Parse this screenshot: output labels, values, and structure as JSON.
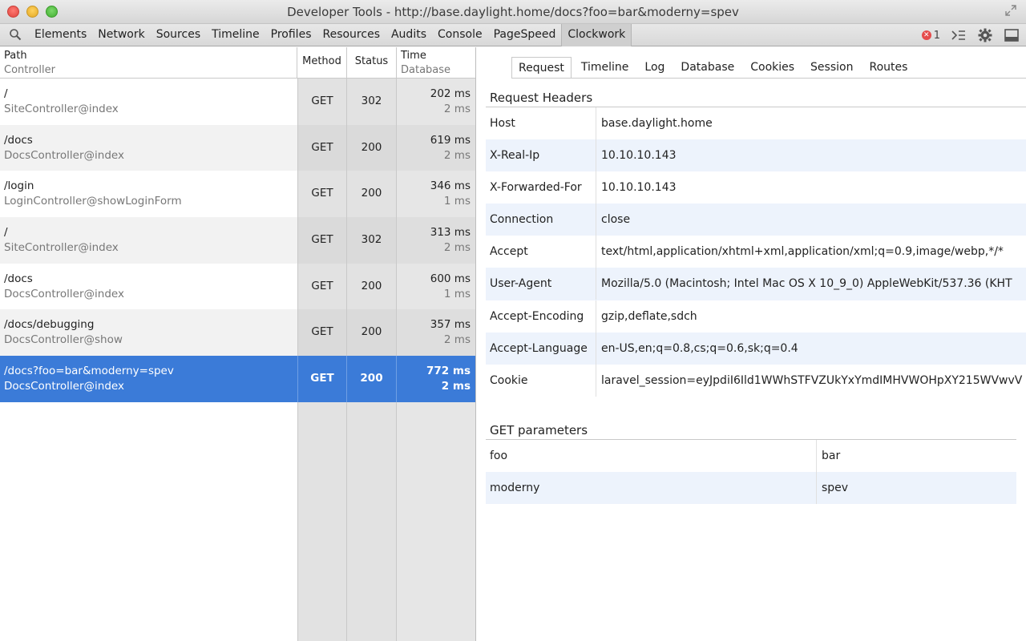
{
  "window": {
    "title": "Developer Tools - http://base.daylight.home/docs?foo=bar&moderny=spev"
  },
  "toolbar": {
    "tabs": [
      "Elements",
      "Network",
      "Sources",
      "Timeline",
      "Profiles",
      "Resources",
      "Audits",
      "Console",
      "PageSpeed",
      "Clockwork"
    ],
    "active_tab": "Clockwork",
    "error_count": "1",
    "error_glyph": "✕"
  },
  "requests_table": {
    "headers": {
      "path": "Path",
      "controller": "Controller",
      "method": "Method",
      "status": "Status",
      "time": "Time",
      "database": "Database"
    },
    "rows": [
      {
        "path": "/",
        "controller": "SiteController@index",
        "method": "GET",
        "status": "302",
        "time": "202 ms",
        "db": "2 ms"
      },
      {
        "path": "/docs",
        "controller": "DocsController@index",
        "method": "GET",
        "status": "200",
        "time": "619 ms",
        "db": "2 ms"
      },
      {
        "path": "/login",
        "controller": "LoginController@showLoginForm",
        "method": "GET",
        "status": "200",
        "time": "346 ms",
        "db": "1 ms"
      },
      {
        "path": "/",
        "controller": "SiteController@index",
        "method": "GET",
        "status": "302",
        "time": "313 ms",
        "db": "2 ms"
      },
      {
        "path": "/docs",
        "controller": "DocsController@index",
        "method": "GET",
        "status": "200",
        "time": "600 ms",
        "db": "1 ms"
      },
      {
        "path": "/docs/debugging",
        "controller": "DocsController@show",
        "method": "GET",
        "status": "200",
        "time": "357 ms",
        "db": "2 ms"
      },
      {
        "path": "/docs?foo=bar&moderny=spev",
        "controller": "DocsController@index",
        "method": "GET",
        "status": "200",
        "time": "772 ms",
        "db": "2 ms"
      }
    ],
    "selected_index": 6
  },
  "detail": {
    "tabs": [
      "Request",
      "Timeline",
      "Log",
      "Database",
      "Cookies",
      "Session",
      "Routes"
    ],
    "active_tab": "Request",
    "request_headers_title": "Request Headers",
    "request_headers": [
      {
        "key": "Host",
        "value": "base.daylight.home"
      },
      {
        "key": "X-Real-Ip",
        "value": "10.10.10.143"
      },
      {
        "key": "X-Forwarded-For",
        "value": "10.10.10.143"
      },
      {
        "key": "Connection",
        "value": "close"
      },
      {
        "key": "Accept",
        "value": "text/html,application/xhtml+xml,application/xml;q=0.9,image/webp,*/*"
      },
      {
        "key": "User-Agent",
        "value": "Mozilla/5.0 (Macintosh; Intel Mac OS X 10_9_0) AppleWebKit/537.36 (KHT"
      },
      {
        "key": "Accept-Encoding",
        "value": "gzip,deflate,sdch"
      },
      {
        "key": "Accept-Language",
        "value": "en-US,en;q=0.8,cs;q=0.6,sk;q=0.4"
      },
      {
        "key": "Cookie",
        "value": "laravel_session=eyJpdiI6Ild1WWhSTFVZUkYxYmdIMHVWOHpXY215WVwvV"
      }
    ],
    "get_params_title": "GET parameters",
    "get_params": [
      {
        "key": "foo",
        "value": "bar"
      },
      {
        "key": "moderny",
        "value": "spev"
      }
    ]
  }
}
